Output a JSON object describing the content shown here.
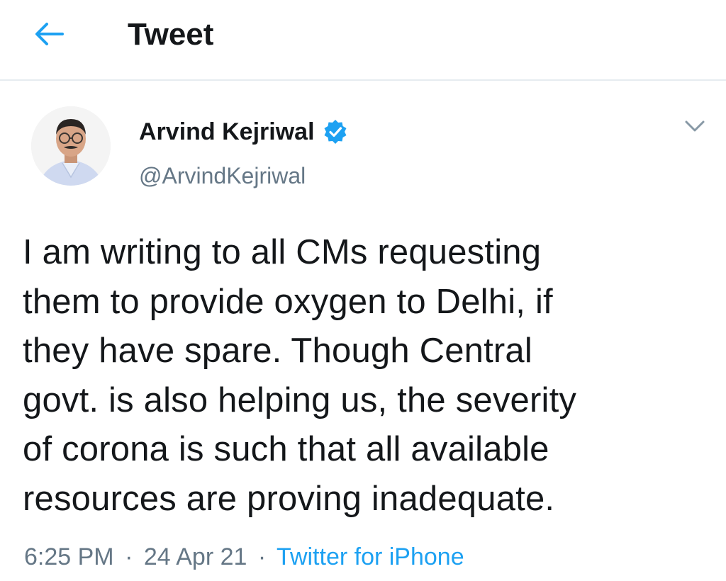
{
  "header": {
    "back_icon": "arrow-left-icon",
    "title": "Tweet"
  },
  "tweet": {
    "author_name": "Arvind Kejriwal",
    "handle": "@ArvindKejriwal",
    "verified_icon": "verified-badge-icon",
    "menu_icon": "chevron-down-icon",
    "text": "I am writing to all CMs requesting\nthem to provide oxygen to Delhi, if\nthey have spare. Though Central\ngovt. is also helping us, the severity\nof corona is such that all available\nresources are proving inadequate.",
    "time": "6:25 PM",
    "separator": "·",
    "date": "24 Apr 21",
    "source": "Twitter for iPhone"
  },
  "colors": {
    "accent": "#1da1f2",
    "text": "#14171a",
    "secondary": "#657786",
    "divider": "#e6ecf0"
  }
}
